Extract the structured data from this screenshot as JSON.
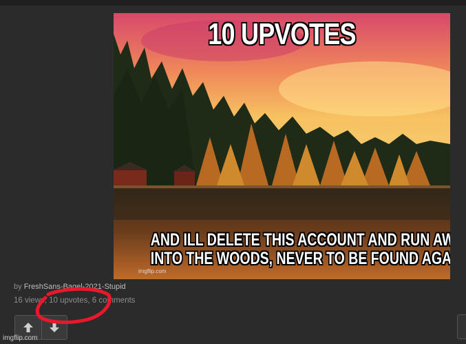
{
  "meme": {
    "top_caption": "10 UPVOTES",
    "bottom_caption_line1": "AND ILL DELETE THIS ACCOUNT AND RUN AWAY",
    "bottom_caption_line2": "INTO THE WOODS, NEVER TO BE FOUND AGAIN",
    "image_watermark": "imgflip.com"
  },
  "post": {
    "by_label": "by",
    "author": "FreshSans-Bagel-2021-Stupid",
    "stats": "16 views, 10 upvotes, 6 comments"
  },
  "controls": {
    "upvote_icon": "arrow-up-icon",
    "downvote_icon": "arrow-down-icon"
  },
  "footer": {
    "site_watermark": "imgflip.com"
  },
  "colors": {
    "background": "#2b2b2b",
    "annotation": "#e8192c"
  }
}
